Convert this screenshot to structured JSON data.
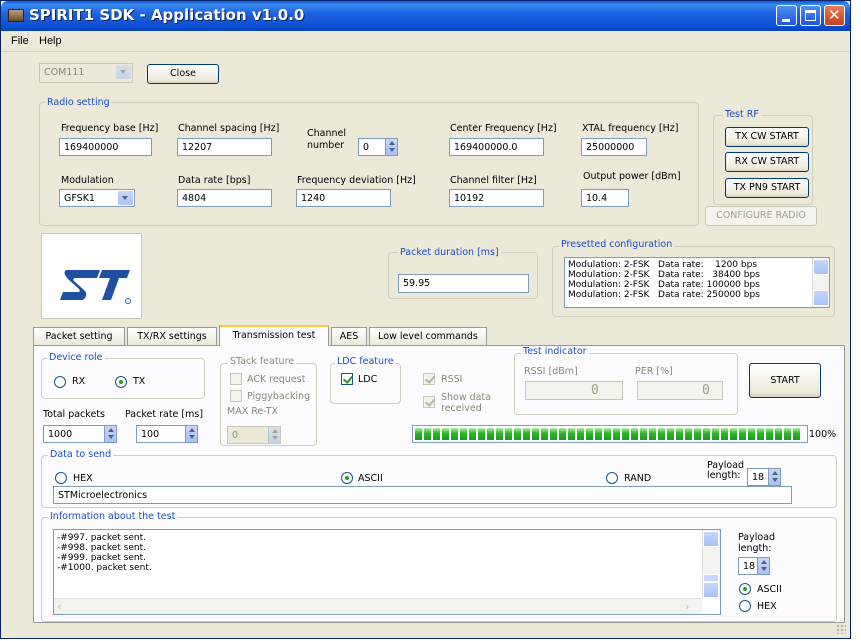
{
  "window": {
    "title": "SPIRIT1 SDK - Application v1.0.0"
  },
  "menu": {
    "file": "File",
    "help": "Help"
  },
  "connection": {
    "port": "COM111",
    "close_label": "Close"
  },
  "radio_setting": {
    "title": "Radio setting",
    "frequency_base": {
      "label": "Frequency base [Hz]",
      "value": "169400000"
    },
    "channel_spacing": {
      "label": "Channel spacing [Hz]",
      "value": "12207"
    },
    "channel_number": {
      "label_line1": "Channel",
      "label_line2": "number",
      "value": "0"
    },
    "center_frequency": {
      "label": "Center Frequency [Hz]",
      "value": "169400000.0"
    },
    "xtal_frequency": {
      "label": "XTAL frequency [Hz]",
      "value": "25000000"
    },
    "modulation": {
      "label": "Modulation",
      "value": "GFSK1"
    },
    "data_rate": {
      "label": "Data rate [bps]",
      "value": "4804"
    },
    "frequency_deviation": {
      "label": "Frequency deviation [Hz]",
      "value": "1240"
    },
    "channel_filter": {
      "label": "Channel filter [Hz]",
      "value": "10192"
    },
    "output_power": {
      "label": "Output power [dBm]",
      "value": "10.4"
    }
  },
  "test_rf": {
    "title": "Test RF",
    "tx_cw": "TX CW START",
    "rx_cw": "RX CW START",
    "tx_pn9": "TX PN9 START",
    "configure": "CONFIGURE RADIO"
  },
  "packet_duration": {
    "label": "Packet duration [ms]",
    "value": "59.95"
  },
  "presetted": {
    "title": "Presetted configuration",
    "rows": [
      "Modulation: 2-FSK   Data rate:    1200 bps",
      "Modulation: 2-FSK   Data rate:   38400 bps",
      "Modulation: 2-FSK   Data rate: 100000 bps",
      "Modulation: 2-FSK   Data rate: 250000 bps"
    ]
  },
  "tabs": [
    "Packet setting",
    "TX/RX settings",
    "Transmission test",
    "AES",
    "Low level commands"
  ],
  "transmission": {
    "device_role": {
      "title": "Device role",
      "rx": "RX",
      "tx": "TX"
    },
    "stack": {
      "title": "STack feature",
      "ack": "ACK request",
      "piggy": "Piggybacking",
      "max_retx": "MAX Re-TX",
      "max_retx_value": "0"
    },
    "ldc": {
      "title": "LDC feature",
      "ldc": "LDC"
    },
    "rssi": "RSSI",
    "show_data_line1": "Show data",
    "show_data_line2": "received",
    "test_indicator": {
      "title": "Test indicator",
      "rssi_label": "RSSI [dBm]",
      "per_label": "PER [%]",
      "rssi_value": "0",
      "per_value": "0"
    },
    "start": "START",
    "total_packets": {
      "label": "Total packets",
      "value": "1000"
    },
    "packet_rate": {
      "label": "Packet rate [ms]",
      "value": "100"
    },
    "progress": {
      "percent": 100,
      "label": "100%"
    }
  },
  "data_to_send": {
    "title": "Data to send",
    "hex": "HEX",
    "ascii": "ASCII",
    "rand": "RAND",
    "payload_line1": "Payload",
    "payload_line2": "length:",
    "payload_value": "18",
    "text": "STMicroelectronics"
  },
  "info": {
    "title": "Information about the test",
    "lines": [
      "-#997. packet sent.",
      "-#998. packet sent.",
      "-#999. packet sent.",
      "-#1000. packet sent."
    ],
    "payload_line1": "Payload",
    "payload_line2": "length:",
    "payload_value": "18",
    "ascii": "ASCII",
    "hex": "HEX"
  },
  "colors": {
    "title_blue": "#1c64e4",
    "group_title": "#1c4ec6",
    "progress_green": "#2bb52b",
    "st_logo_blue": "#1e4fa0"
  }
}
